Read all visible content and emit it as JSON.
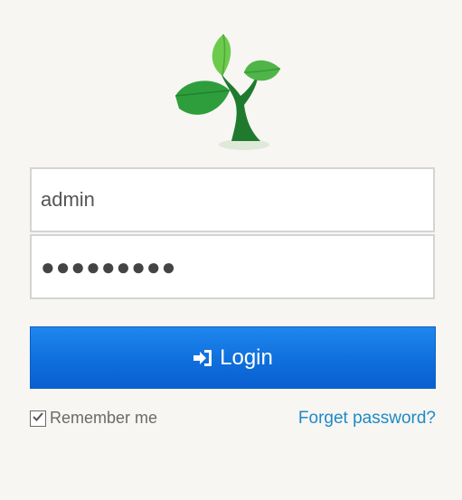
{
  "logo": {
    "icon": "tree-sprout-icon"
  },
  "login_form": {
    "username": {
      "value": "admin"
    },
    "password": {
      "masked_value": "●●●●●●●●●"
    },
    "login_button": {
      "label": "Login",
      "icon": "sign-in-icon"
    },
    "remember_me": {
      "label": "Remember me",
      "checked": true
    },
    "forgot_password": {
      "label": "Forget password?"
    }
  },
  "colors": {
    "background": "#f7f6f2",
    "button_blue": "#0f6fdc",
    "link_blue": "#1d8ac7",
    "leaf_green": "#2f9e3c",
    "trunk_green": "#1f6e2a"
  }
}
